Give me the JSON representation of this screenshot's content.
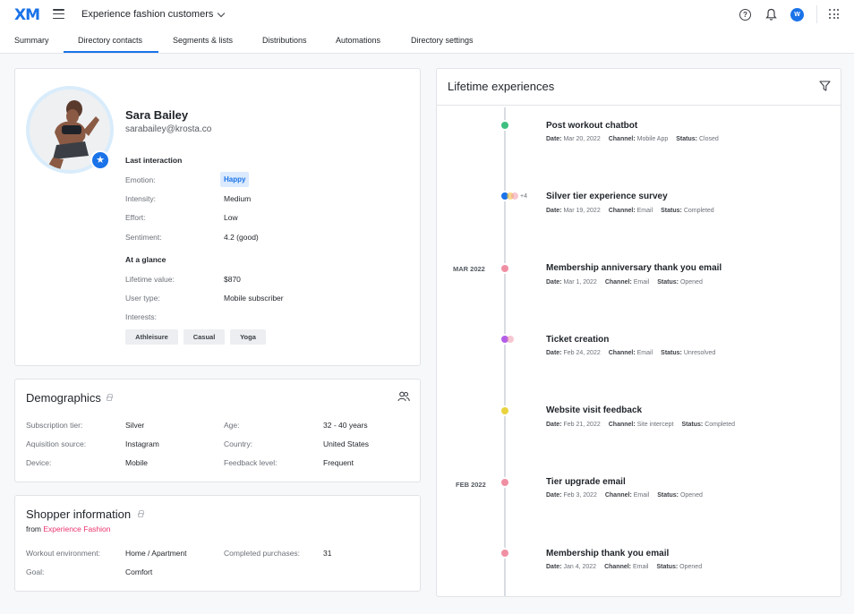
{
  "app": {
    "logo": "XM",
    "project": "Experience fashion customers",
    "avatar_initial": "W",
    "help_glyph": "?"
  },
  "tabs": [
    "Summary",
    "Directory contacts",
    "Segments & lists",
    "Distributions",
    "Automations",
    "Directory settings"
  ],
  "active_tab": "Directory contacts",
  "profile": {
    "name": "Sara Bailey",
    "email": "sarabailey@krosta.co",
    "last_interaction_title": "Last interaction",
    "emotion_label": "Emotion:",
    "emotion_value": "Happy",
    "intensity_label": "Intensity:",
    "intensity_value": "Medium",
    "effort_label": "Effort:",
    "effort_value": "Low",
    "sentiment_label": "Sentiment:",
    "sentiment_value": "4.2 (good)",
    "glance_title": "At a glance",
    "lifetime_label": "Lifetime value:",
    "lifetime_value": "$870",
    "usertype_label": "User type:",
    "usertype_value": "Mobile subscriber",
    "interests_label": "Interests:",
    "interests": [
      "Athleisure",
      "Casual",
      "Yoga"
    ]
  },
  "demographics": {
    "title": "Demographics",
    "sub_label": "Subscription tier:",
    "sub_value": "Silver",
    "acq_label": "Aquisition source:",
    "acq_value": "Instagram",
    "device_label": "Device:",
    "device_value": "Mobile",
    "age_label": "Age:",
    "age_value": "32 - 40 years",
    "country_label": "Country:",
    "country_value": "United States",
    "feedback_label": "Feedback level:",
    "feedback_value": "Frequent"
  },
  "shopper": {
    "title": "Shopper information",
    "from_prefix": "from",
    "from_brand": "Experience Fashion",
    "workout_label": "Workout environment:",
    "workout_value": "Home / Apartment",
    "goal_label": "Goal:",
    "goal_value": "Comfort",
    "purchases_label": "Completed purchases:",
    "purchases_value": "31"
  },
  "timeline": {
    "title": "Lifetime experiences",
    "extra_count": "+4",
    "months": [
      "MAR 2022",
      "FEB 2022"
    ],
    "field_labels": {
      "date": "Date:",
      "channel": "Channel:",
      "status": "Status:"
    },
    "events": [
      {
        "title": "Post workout chatbot",
        "date": "Mar 20, 2022",
        "channel": "Mobile App",
        "status": "Closed",
        "color": "#3fbf7f"
      },
      {
        "title": "Silver tier experience survey",
        "date": "Mar 19, 2022",
        "channel": "Email",
        "status": "Completed",
        "color": "#1a73e8"
      },
      {
        "title": "Membership anniversary thank you email",
        "date": "Mar 1, 2022",
        "channel": "Email",
        "status": "Opened",
        "color": "#f08fa3"
      },
      {
        "title": "Ticket creation",
        "date": "Feb 24, 2022",
        "channel": "Email",
        "status": "Unresolved",
        "color": "#b35de8"
      },
      {
        "title": "Website visit feedback",
        "date": "Feb 21, 2022",
        "channel": "Site intercept",
        "status": "Completed",
        "color": "#e8d33f"
      },
      {
        "title": "Tier upgrade email",
        "date": "Feb 3, 2022",
        "channel": "Email",
        "status": "Opened",
        "color": "#f08fa3"
      },
      {
        "title": "Membership thank you email",
        "date": "Jan 4, 2022",
        "channel": "Email",
        "status": "Opened",
        "color": "#f08fa3"
      }
    ]
  }
}
